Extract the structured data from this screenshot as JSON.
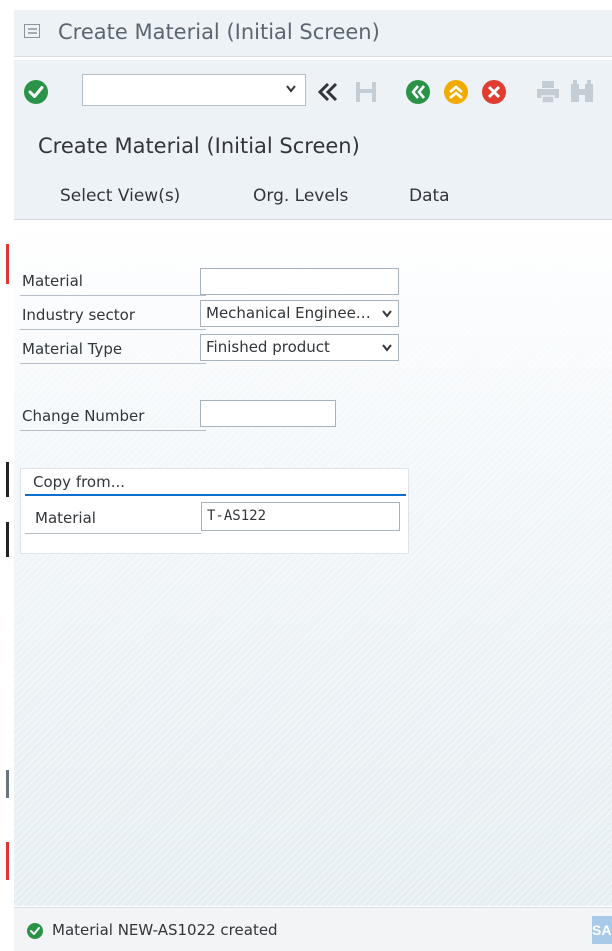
{
  "window": {
    "title": "Create Material (Initial Screen)"
  },
  "toolbar": {
    "command_field_value": "",
    "buttons": [
      "enter-icon",
      "command-dropdown-icon",
      "collapse-toolbar-icon",
      "save-icon",
      "back-icon",
      "exit-icon",
      "cancel-icon",
      "print-icon",
      "find-icon"
    ]
  },
  "header": {
    "title": "Create Material (Initial Screen)"
  },
  "app_toolbar": {
    "select_views": "Select View(s)",
    "org_levels": "Org. Levels",
    "data": "Data"
  },
  "form": {
    "material_label": "Material",
    "material_value": "",
    "industry_sector_label": "Industry sector",
    "industry_sector_value": "Mechanical Enginee…",
    "material_type_label": "Material Type",
    "material_type_value": "Finished product",
    "change_number_label": "Change Number",
    "change_number_value": ""
  },
  "copy_from": {
    "title": "Copy from...",
    "material_label": "Material",
    "material_value": "T-AS122"
  },
  "status": {
    "message": "Material NEW-AS1022 created",
    "logo_text": "SAP"
  },
  "colors": {
    "enter_green": "#2b9348",
    "back_green": "#2b9348",
    "exit_yellow": "#f0ab00",
    "cancel_red": "#e03c31",
    "accent_blue": "#0a6ed1",
    "shell_bg": "#edf2f7"
  }
}
